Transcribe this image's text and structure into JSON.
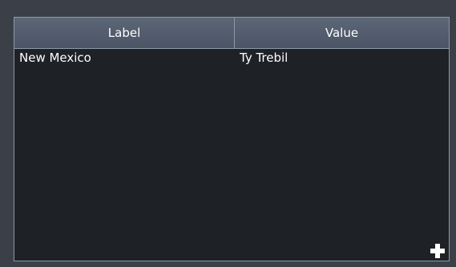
{
  "table": {
    "columns": [
      {
        "label": "Label"
      },
      {
        "label": "Value"
      }
    ],
    "rows": [
      {
        "label": "New Mexico",
        "value": "Ty Trebil"
      }
    ]
  },
  "icons": {
    "add": "plus-icon"
  },
  "colors": {
    "background": "#3b4048",
    "table_body": "#1e2125",
    "header": "#55606f",
    "border": "#8d97a6",
    "text": "#ffffff"
  }
}
